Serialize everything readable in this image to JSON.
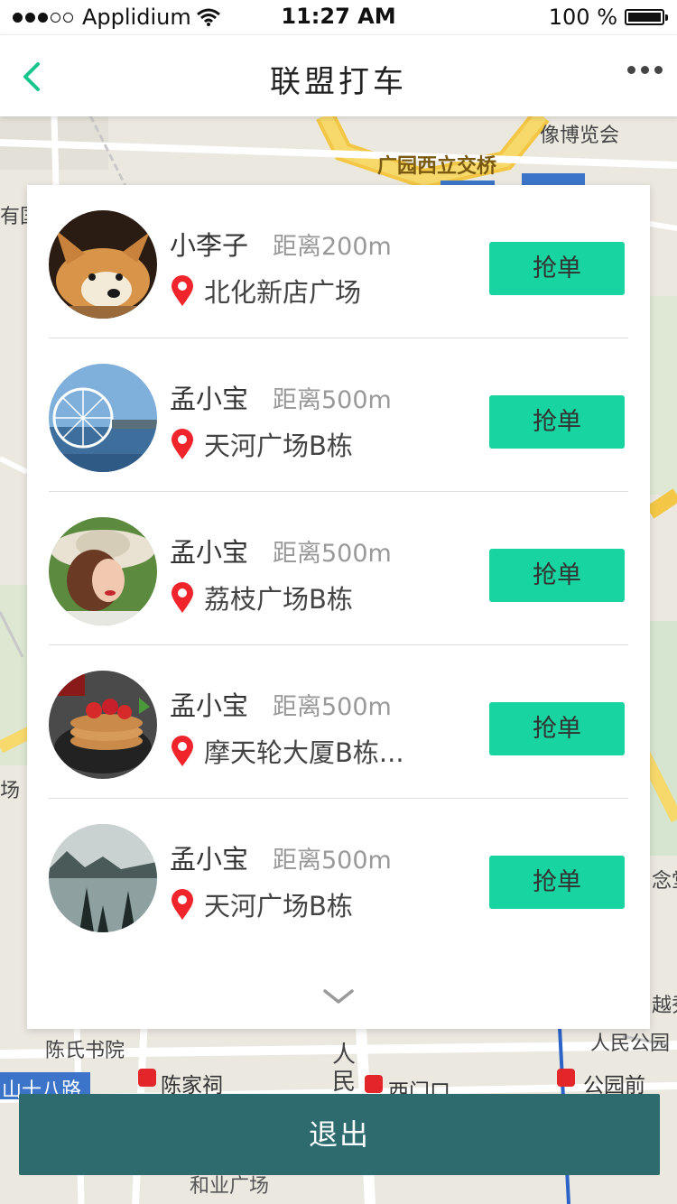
{
  "status_bar": {
    "carrier": "Applidium",
    "time": "11:27 AM",
    "battery": "100 %",
    "signal_dots_filled": 3,
    "signal_dots_total": 5
  },
  "nav": {
    "title": "联盟打车",
    "back_icon": "chevron-left-icon",
    "more_icon": "more-horizontal-icon"
  },
  "map_labels": {
    "l1": "像博览会",
    "l2": "广园西立交桥",
    "l3": "有国",
    "l4": "陈氏书院",
    "l5": "陈家祠",
    "l6": "西门口",
    "l7": "公园前",
    "l8": "人民公园",
    "l9": "山十八路",
    "l10": "人",
    "l11": "民",
    "l12": "和业广场",
    "l13": "越秀",
    "l14": "念堂",
    "l15": "场"
  },
  "requests": [
    {
      "name": "小李子",
      "distance": "距离200m",
      "address": "北化新店广场",
      "button": "抢单"
    },
    {
      "name": "孟小宝",
      "distance": "距离500m",
      "address": "天河广场B栋",
      "button": "抢单"
    },
    {
      "name": "孟小宝",
      "distance": "距离500m",
      "address": "荔枝广场B栋",
      "button": "抢单"
    },
    {
      "name": "孟小宝",
      "distance": "距离500m",
      "address": "摩天轮大厦B栋...",
      "button": "抢单"
    },
    {
      "name": "孟小宝",
      "distance": "距离500m",
      "address": "天河广场B栋",
      "button": "抢单"
    }
  ],
  "expand_icon": "chevron-down-icon",
  "logout_label": "退出",
  "colors": {
    "accent": "#17d4a1",
    "logout_bg": "#2d6b6f",
    "back_arrow": "#17c58e",
    "pin": "#f0252b"
  }
}
